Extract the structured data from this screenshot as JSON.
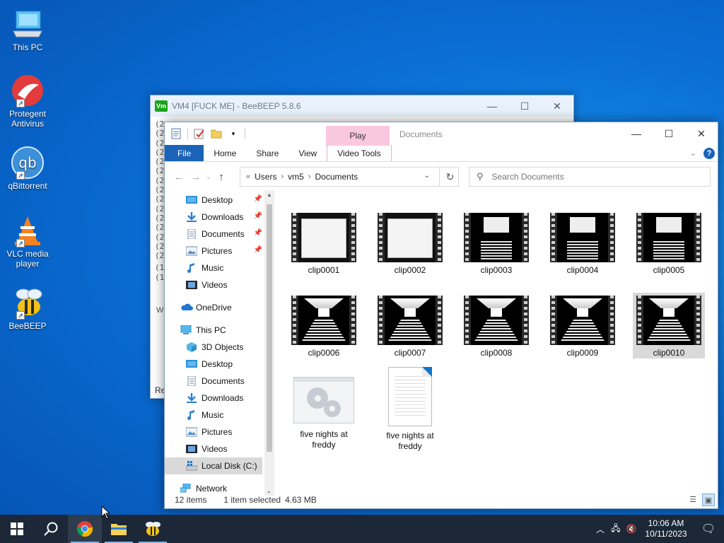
{
  "desktop": {
    "icons": [
      {
        "label": "This PC"
      },
      {
        "label": "Protegent Antivirus"
      },
      {
        "label": "qBittorrent"
      },
      {
        "label": "VLC media player"
      },
      {
        "label": "BeeBEEP"
      }
    ]
  },
  "beebeep": {
    "title": "VM4 [FUCK ME] - BeeBEEP 5.8.6",
    "logo": "Vm",
    "log_prefixes": [
      "(2",
      "(2",
      "(2",
      "(2",
      "(2",
      "(2",
      "(2",
      "(2",
      "(2",
      "(2",
      "(2",
      "(2",
      "(2",
      "(2",
      "(2",
      "(1",
      "(1"
    ],
    "side_label": "W",
    "status_text": "Re"
  },
  "explorer": {
    "context_tab": "Play",
    "title": "Documents",
    "ribbon_tabs": [
      "File",
      "Home",
      "Share",
      "View",
      "Video Tools"
    ],
    "breadcrumb": [
      "Users",
      "vm5",
      "Documents"
    ],
    "breadcrumb_prefix": "«",
    "search_placeholder": "Search Documents",
    "nav": {
      "quick_access": [
        {
          "label": "Desktop",
          "pinned": true
        },
        {
          "label": "Downloads",
          "pinned": true
        },
        {
          "label": "Documents",
          "pinned": true
        },
        {
          "label": "Pictures",
          "pinned": true
        },
        {
          "label": "Music",
          "pinned": false
        },
        {
          "label": "Videos",
          "pinned": false
        }
      ],
      "onedrive": "OneDrive",
      "this_pc": "This PC",
      "this_pc_items": [
        "3D Objects",
        "Desktop",
        "Documents",
        "Downloads",
        "Music",
        "Pictures",
        "Videos",
        "Local Disk (C:)"
      ],
      "network": "Network"
    },
    "files": [
      {
        "name": "clip0001",
        "kind": "video-a"
      },
      {
        "name": "clip0002",
        "kind": "video-a"
      },
      {
        "name": "clip0003",
        "kind": "video-b"
      },
      {
        "name": "clip0004",
        "kind": "video-b"
      },
      {
        "name": "clip0005",
        "kind": "video-b"
      },
      {
        "name": "clip0006",
        "kind": "video-c"
      },
      {
        "name": "clip0007",
        "kind": "video-c"
      },
      {
        "name": "clip0008",
        "kind": "video-c"
      },
      {
        "name": "clip0009",
        "kind": "video-c"
      },
      {
        "name": "clip0010",
        "kind": "video-c",
        "selected": true
      },
      {
        "name": "five nights at freddy",
        "kind": "app"
      },
      {
        "name": "five nights at freddy",
        "kind": "doc"
      }
    ],
    "status": {
      "count": "12 items",
      "selection": "1 item selected",
      "size": "4.63 MB"
    }
  },
  "taskbar": {
    "time": "10:06 AM",
    "date": "10/11/2023"
  },
  "colors": {
    "accent": "#1a63b8",
    "taskbar": "#1c2838",
    "video_tools_tab": "#f9c8df"
  }
}
